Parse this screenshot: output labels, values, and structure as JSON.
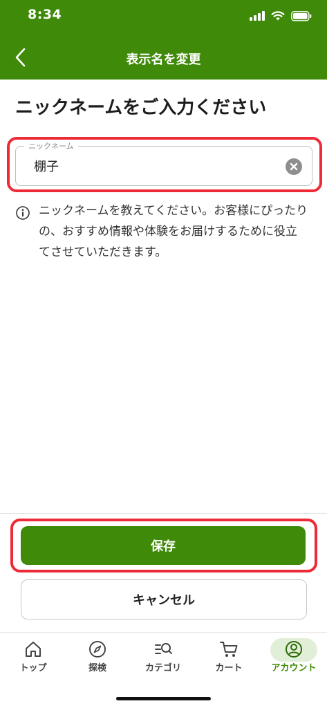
{
  "status_bar": {
    "time": "8:34"
  },
  "header": {
    "title": "表示名を変更"
  },
  "page": {
    "heading": "ニックネームをご入力ください"
  },
  "nickname_field": {
    "label": "ニックネーム",
    "value": "棚子"
  },
  "info": {
    "text": "ニックネームを教えてください。お客様にぴったりの、おすすめ情報や体験をお届けするために役立てさせていただきます。"
  },
  "actions": {
    "save_label": "保存",
    "cancel_label": "キャンセル"
  },
  "tabbar": {
    "items": [
      {
        "label": "トップ",
        "icon": "home-icon"
      },
      {
        "label": "探検",
        "icon": "compass-icon"
      },
      {
        "label": "カテゴリ",
        "icon": "category-search-icon"
      },
      {
        "label": "カート",
        "icon": "cart-icon"
      },
      {
        "label": "アカウント",
        "icon": "account-icon",
        "active": true
      }
    ]
  },
  "colors": {
    "brand_green": "#3f8a08",
    "highlight_red": "#ee2a36",
    "active_tab_bg": "#e2efd8"
  }
}
